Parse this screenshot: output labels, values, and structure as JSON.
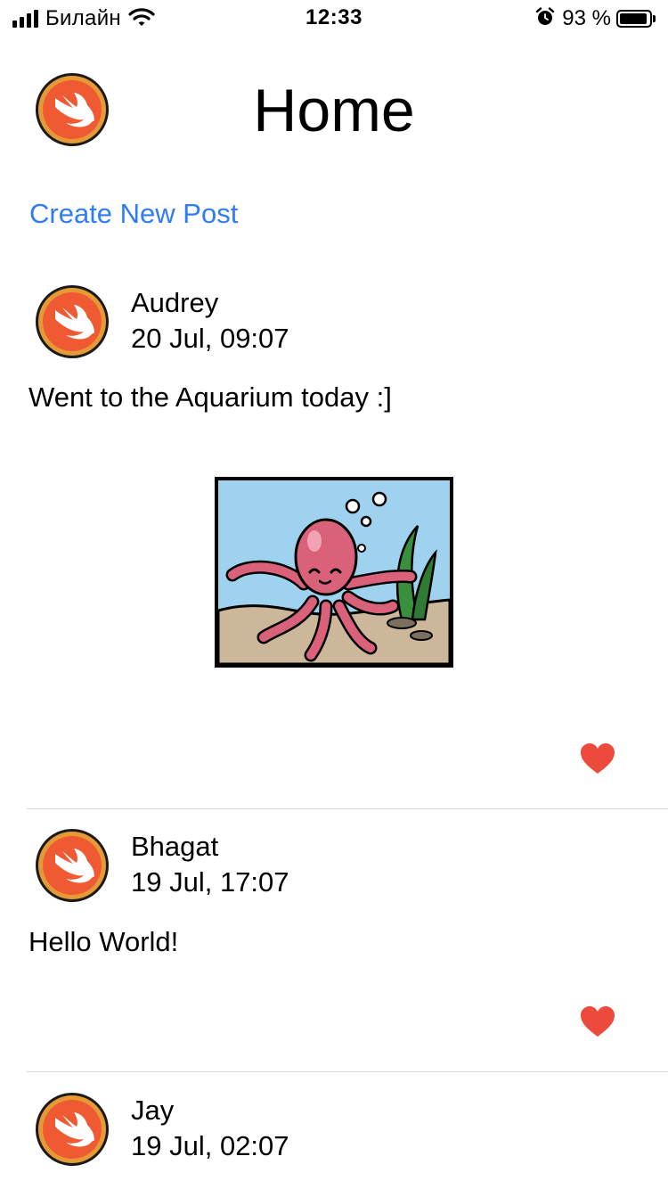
{
  "status_bar": {
    "carrier": "Билайн",
    "time": "12:33",
    "battery_percent": "93 %",
    "battery_level": 0.93,
    "icons": [
      "signal-icon",
      "wifi-icon",
      "alarm-icon",
      "battery-icon"
    ]
  },
  "header": {
    "title": "Home",
    "create_post_label": "Create New Post",
    "avatar_icon": "swift-logo-avatar"
  },
  "colors": {
    "link": "#2f7cf6",
    "like": "#eb4a3c",
    "divider": "#d6d6d6",
    "avatar_ring": "#e07a1c"
  },
  "posts": [
    {
      "author": "Audrey",
      "timestamp": "20 Jul, 09:07",
      "text": "Went to the Aquarium today :]",
      "image": "octopus-aquarium-illustration",
      "liked": true
    },
    {
      "author": "Bhagat",
      "timestamp": "19 Jul, 17:07",
      "text": "Hello World!",
      "liked": true
    },
    {
      "author": "Jay",
      "timestamp": "19 Jul, 02:07",
      "liked": false
    }
  ]
}
